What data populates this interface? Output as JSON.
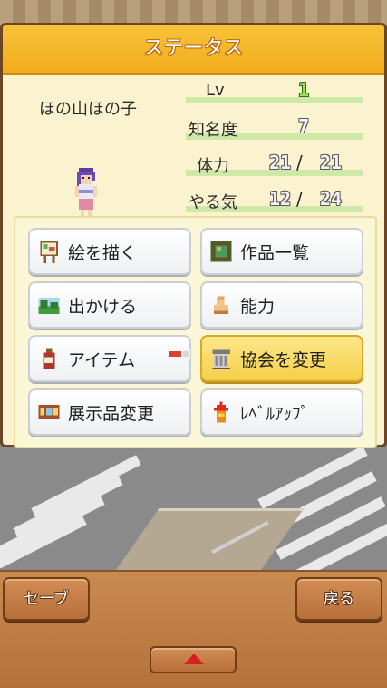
{
  "panel": {
    "title": "ステータス"
  },
  "character": {
    "name": "ほの山ほの子"
  },
  "stats": {
    "level_label": "Lv",
    "level_value": "1",
    "fame_label": "知名度",
    "fame_value": "7",
    "stamina_label": "体力",
    "stamina_current": "21",
    "stamina_max": "21",
    "motivation_label": "やる気",
    "motivation_current": "12",
    "motivation_max": "24",
    "separator": "/"
  },
  "menu": {
    "items": [
      {
        "label": "絵を描く",
        "icon": "easel-icon"
      },
      {
        "label": "作品一覧",
        "icon": "painting-frame-icon"
      },
      {
        "label": "出かける",
        "icon": "landscape-icon"
      },
      {
        "label": "能力",
        "icon": "muscle-arm-icon"
      },
      {
        "label": "アイテム",
        "icon": "bottle-icon"
      },
      {
        "label": "協会を変更",
        "icon": "building-icon"
      },
      {
        "label": "展示品変更",
        "icon": "gallery-icon"
      },
      {
        "label": "ﾚﾍﾞﾙｱｯﾌﾟ",
        "icon": "level-up-arrow-icon"
      }
    ],
    "selected_index": 5
  },
  "bottom": {
    "save_label": "セーブ",
    "back_label": "戻る",
    "up_icon": "triangle-up-icon"
  },
  "colors": {
    "title_bar": "#f2ad1c",
    "panel_bg": "#fbf3cf",
    "selected_button": "#f5cf48",
    "stat_green": "#9de05a"
  }
}
